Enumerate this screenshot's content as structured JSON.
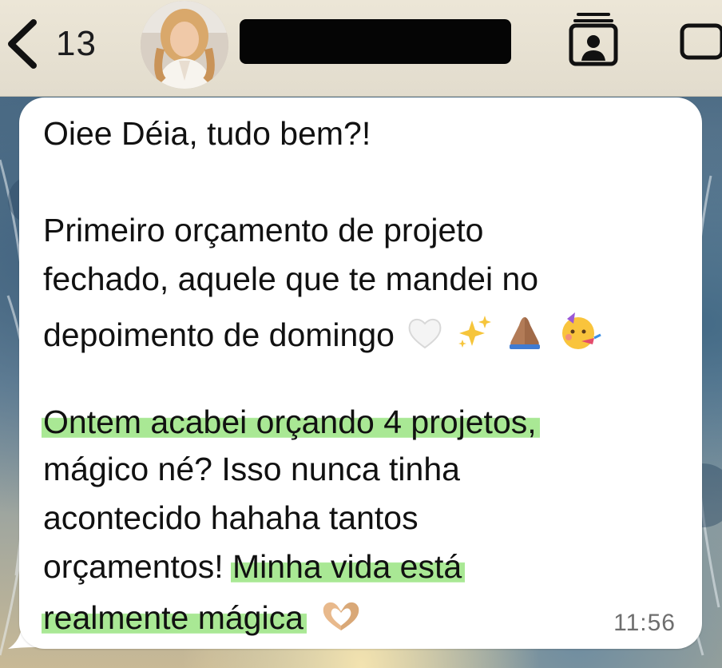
{
  "header": {
    "unread_count": "13",
    "contact_name": "",
    "icons": {
      "back": "chevron-left-icon",
      "contact_info": "contact-card-icon",
      "video": "video-camera-icon"
    }
  },
  "message": {
    "greeting": "Oiee Déia, tudo bem?!",
    "para1_line1": "Primeiro orçamento de projeto",
    "para1_line2": "fechado, aquele que te mandei no",
    "para1_line3": "depoimento de domingo",
    "para1_emojis": [
      "white-heart",
      "sparkles",
      "folded-hands",
      "partying-face"
    ],
    "para2_line1": "Ontem acabei orçando 4 projetos,",
    "para2_line2": "mágico né? Isso nunca tinha",
    "para2_line3": "acontecido hahaha tantos",
    "para2_line4_plain": "orçamentos! ",
    "para2_line4_highlight": "Minha vida está",
    "para2_line5": "realmente mágica",
    "para2_emoji": "heart-hands",
    "time": "11:56",
    "highlight_color": "#9ae482"
  },
  "colors": {
    "bubble": "#ffffff",
    "header_bg": "#ece6d7",
    "text": "#111111",
    "timestamp": "#6e6e6e"
  }
}
